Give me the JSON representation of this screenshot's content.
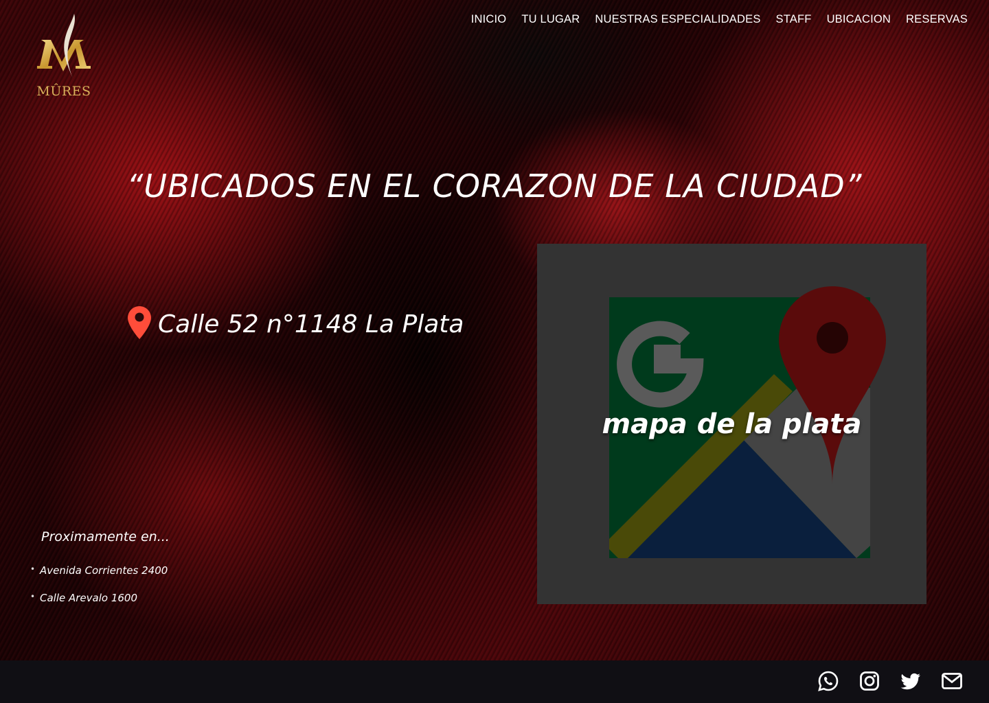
{
  "brand": {
    "name": "MÛRES",
    "colors": {
      "gold": "#d8b15a",
      "accent_red": "#ff4d3a"
    }
  },
  "nav": {
    "items": [
      "INICIO",
      "TU LUGAR",
      "NUESTRAS ESPECIALIDADES",
      "STAFF",
      "UBICACION",
      "RESERVAS"
    ]
  },
  "hero": {
    "headline": "“UBICADOS EN EL CORAZON DE LA CIUDAD”"
  },
  "location": {
    "icon": "map-pin-icon",
    "address": "Calle 52 n°1148 La Plata"
  },
  "coming_soon": {
    "title": "Proximamente en...",
    "items": [
      "Avenida Corrientes  2400",
      "Calle Arevalo 1600"
    ]
  },
  "map": {
    "label": "mapa de la plata",
    "icon": "google-maps-icon"
  },
  "footer": {
    "socials": [
      "whatsapp-icon",
      "instagram-icon",
      "twitter-icon",
      "mail-icon"
    ]
  }
}
